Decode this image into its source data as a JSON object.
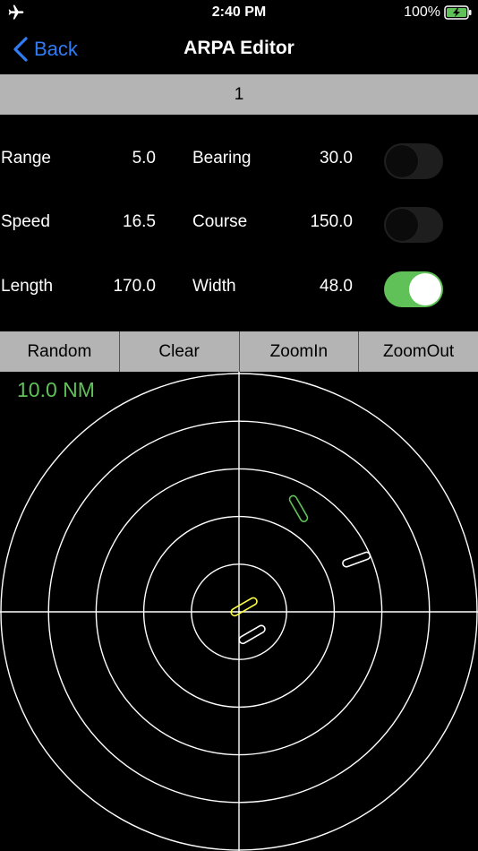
{
  "status": {
    "time": "2:40 PM",
    "battery_percent": "100%",
    "battery_level": 1.0
  },
  "nav": {
    "back_label": "Back",
    "title": "ARPA Editor"
  },
  "selector": {
    "value": "1"
  },
  "params": [
    {
      "label_a": "Range",
      "value_a": "5.0",
      "label_b": "Bearing",
      "value_b": "30.0",
      "toggle_on": false
    },
    {
      "label_a": "Speed",
      "value_a": "16.5",
      "label_b": "Course",
      "value_b": "150.0",
      "toggle_on": false
    },
    {
      "label_a": "Length",
      "value_a": "170.0",
      "label_b": "Width",
      "value_b": "48.0",
      "toggle_on": true
    }
  ],
  "buttons": {
    "random": "Random",
    "clear": "Clear",
    "zoomin": "ZoomIn",
    "zoomout": "ZoomOut"
  },
  "radar": {
    "range_label": "10.0 NM",
    "range_nm": 10.0,
    "ring_count": 5,
    "accent_color": "#5fc158",
    "targets": [
      {
        "range_nm": 5.0,
        "bearing_deg": 30,
        "heading_deg": 150,
        "color": "#5fc158"
      },
      {
        "range_nm": 5.4,
        "bearing_deg": 66,
        "heading_deg": 70,
        "color": "#ffffff"
      },
      {
        "range_nm": 1.1,
        "bearing_deg": 150,
        "heading_deg": 60,
        "color": "#ffffff"
      },
      {
        "range_nm": 0.3,
        "bearing_deg": 45,
        "heading_deg": 60,
        "color": "#ffff44"
      }
    ]
  },
  "colors": {
    "bar_gray": "#b4b4b4",
    "ios_blue": "#2f7cf6",
    "toggle_green": "#5fc158"
  }
}
